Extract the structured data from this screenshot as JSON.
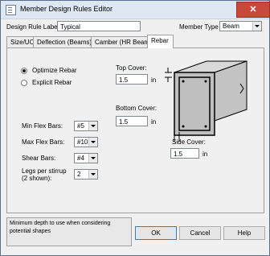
{
  "window": {
    "title": "Member Design Rules Editor",
    "close_glyph": "✕"
  },
  "header": {
    "rule_label": "Design Rule Label",
    "rule_value": "Typical",
    "member_type_label": "Member Type",
    "member_type_value": "Beam"
  },
  "tabs": [
    {
      "label": "Size/UC"
    },
    {
      "label": "Deflection (Beams)"
    },
    {
      "label": "Camber (HR Beams)"
    },
    {
      "label": "Rebar"
    }
  ],
  "active_tab": "Rebar",
  "rebar": {
    "optimize_label": "Optimize Rebar",
    "explicit_label": "Explicit Rebar",
    "selected_option": "Optimize Rebar",
    "top_cover_label": "Top Cover:",
    "top_cover_value": "1.5",
    "bottom_cover_label": "Bottom Cover:",
    "bottom_cover_value": "1.5",
    "side_cover_label": "Side Cover:",
    "side_cover_value": "1.5",
    "unit": "in",
    "min_flex_label": "Min Flex Bars:",
    "min_flex_value": "#5",
    "max_flex_label": "Max Flex Bars:",
    "max_flex_value": "#10",
    "shear_label": "Shear Bars:",
    "shear_value": "#4",
    "legs_label_1": "Legs per stirrup",
    "legs_label_2": "(2 shown):",
    "legs_value": "2"
  },
  "hint_text": "Minimum depth to use when considering potential shapes",
  "buttons": {
    "ok": "OK",
    "cancel": "Cancel",
    "help": "Help"
  },
  "icons": [
    "app-icon",
    "close-icon",
    "chevron-down-icon",
    "beam-section-diagram"
  ]
}
